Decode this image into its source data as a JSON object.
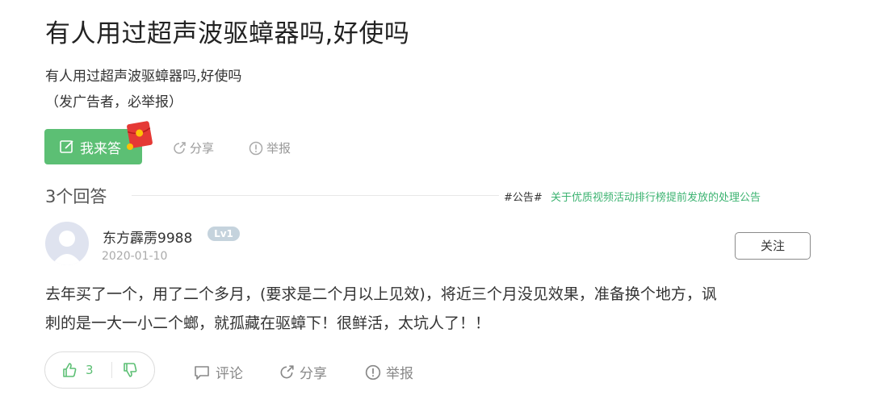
{
  "question": {
    "title": "有人用过超声波驱蟑器吗,好使吗",
    "description_line1": "有人用过超声波驱蟑器吗,好使吗",
    "description_line2": "（发广告者，必举报）"
  },
  "actions": {
    "answer_label": "我来答",
    "share_label": "分享",
    "report_label": "举报"
  },
  "answers_header": {
    "count_label": "3个回答",
    "notice_tag": "#公告#",
    "notice_link": "关于优质视频活动排行榜提前发放的处理公告"
  },
  "answer": {
    "username": "东方霹雳9988",
    "level": "Lv1",
    "date": "2020-01-10",
    "follow_label": "关注",
    "text_line1": "去年买了一个，用了二个多月，(要求是二个月以上见效)，将近三个月没见效果，准备换个地方，讽",
    "text_line2": "刺的是一大一小二个螂，就孤藏在驱蟑下！很鲜活，太坑人了！！",
    "upvotes": "3",
    "comment_label": "评论",
    "share_label": "分享",
    "report_label": "举报"
  },
  "colors": {
    "accent_green": "#5cbf74",
    "notice_green": "#3cb371",
    "badge_gray": "#c5d3dd"
  }
}
